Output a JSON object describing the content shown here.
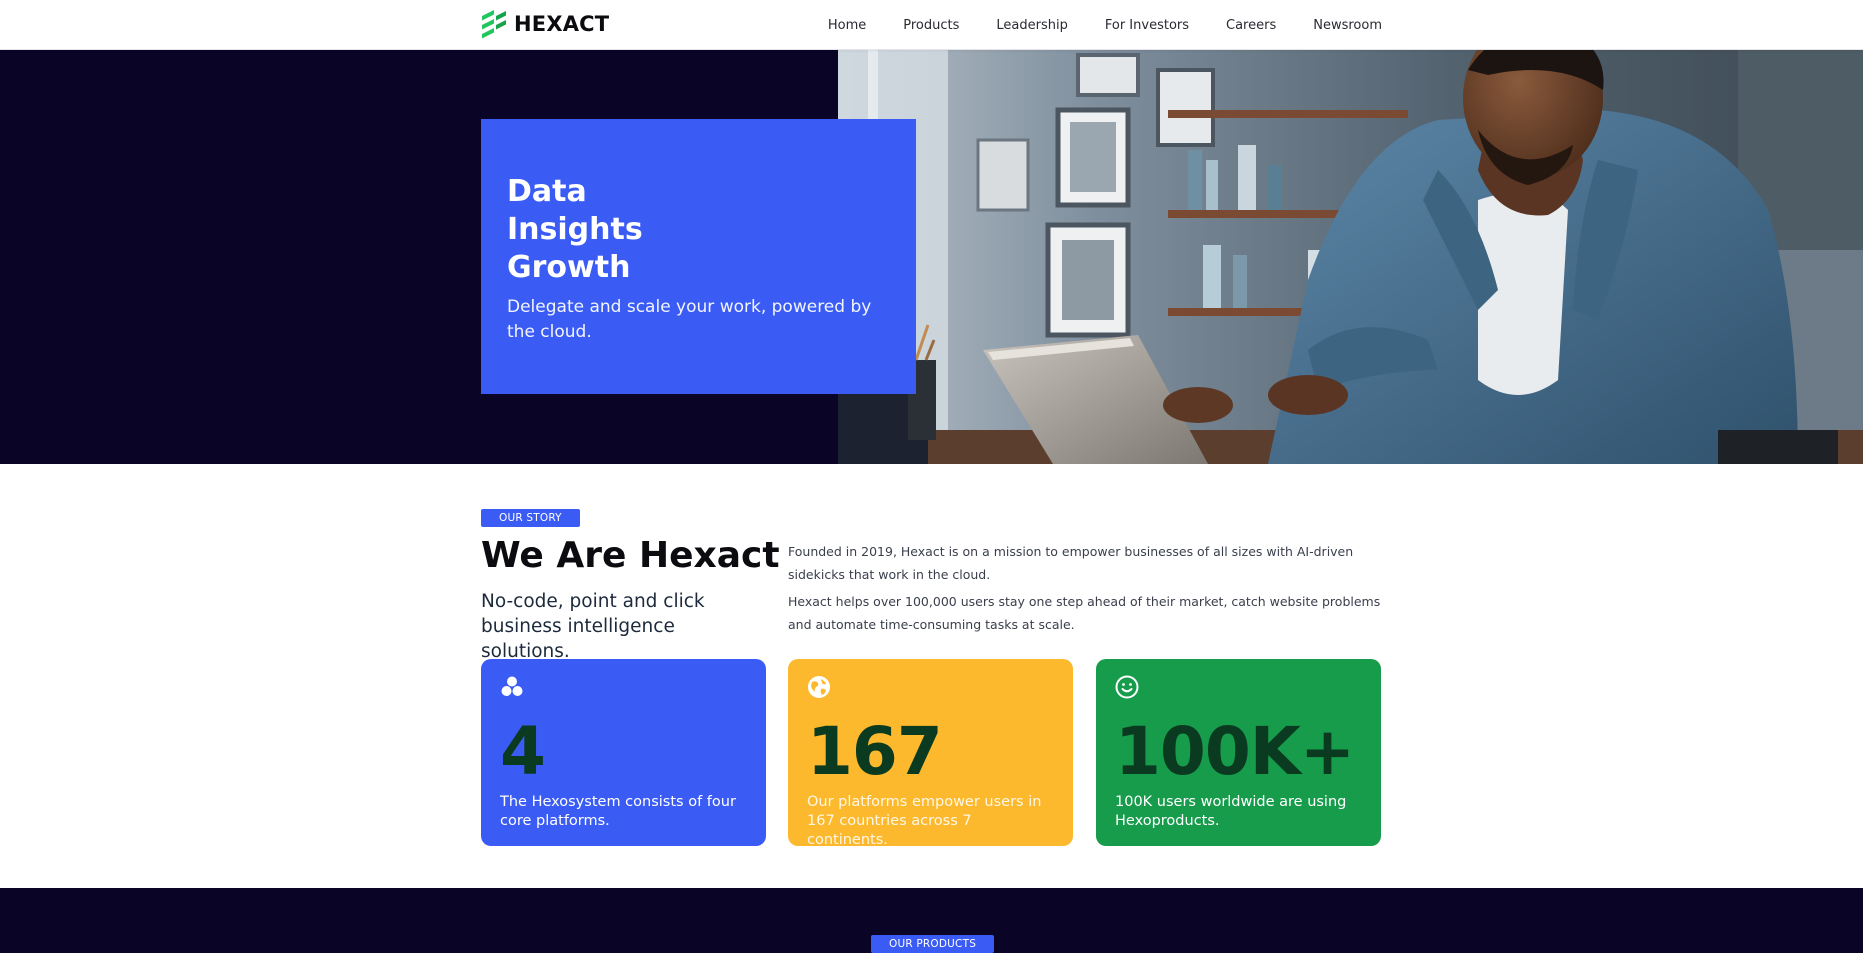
{
  "brand": {
    "name": "HEXACT",
    "accent": "#3a5cf5",
    "logo_green": "#22c55e",
    "navy": "#0a0526"
  },
  "nav": {
    "items": [
      {
        "label": "Home"
      },
      {
        "label": "Products"
      },
      {
        "label": "Leadership"
      },
      {
        "label": "For Investors"
      },
      {
        "label": "Careers"
      },
      {
        "label": "Newsroom"
      }
    ]
  },
  "hero": {
    "title_lines": [
      "Data",
      "Insights",
      "Growth"
    ],
    "subtitle": "Delegate and scale your work, powered by the cloud.",
    "photo_icon": "person-at-laptop-photo"
  },
  "story": {
    "badge": "OUR STORY",
    "title": "We Are Hexact",
    "subtitle": "No-code, point and click business intelligence solutions.",
    "paragraphs": [
      "Founded in 2019, Hexact is on a mission to empower businesses of all sizes with AI-driven sidekicks that work in the cloud.",
      "Hexact helps over 100,000 users stay one step ahead of their market, catch website problems and automate time-consuming tasks at scale."
    ]
  },
  "stats": [
    {
      "icon": "hexagon-cluster-icon",
      "value": "4",
      "description": "The Hexosystem consists of four core platforms.",
      "color": "#3a5cf5"
    },
    {
      "icon": "globe-icon",
      "value": "167",
      "description": "Our platforms empower users in 167 countries across 7 continents.",
      "color": "#fdb92d"
    },
    {
      "icon": "smiley-icon",
      "value": "100K+",
      "description": "100K users worldwide are using Hexoproducts.",
      "color": "#179c4c"
    }
  ],
  "products": {
    "badge": "OUR PRODUCTS"
  }
}
